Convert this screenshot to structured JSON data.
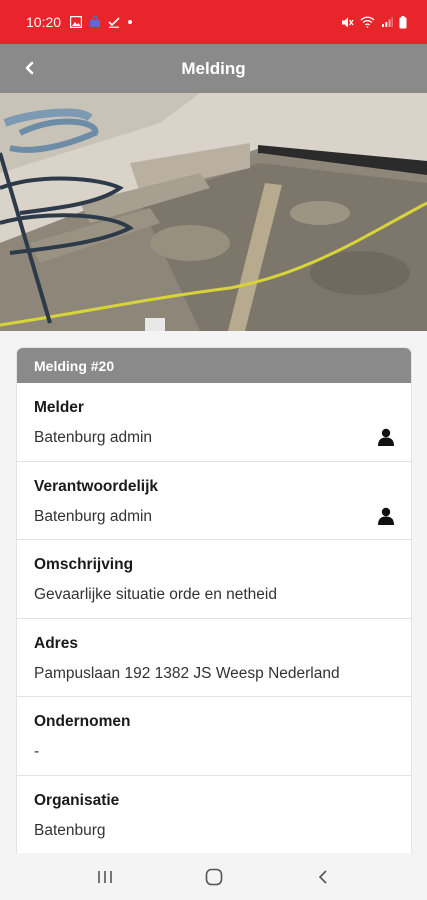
{
  "status_bar": {
    "time": "10:20",
    "left_icons": [
      "image-icon",
      "bag-icon",
      "checkmark-icon",
      "dot-icon"
    ],
    "right_icons": [
      "mute-icon",
      "wifi-icon",
      "signal-icon",
      "battery-icon"
    ],
    "color": "#e8252b"
  },
  "header": {
    "title": "Melding",
    "back_icon": "chevron-left-icon",
    "color": "#8a8a8a"
  },
  "photo": {
    "icon": "site-photo"
  },
  "card": {
    "title": "Melding #20",
    "fields": [
      {
        "label": "Melder",
        "value": "Batenburg admin",
        "icon": "person-icon"
      },
      {
        "label": "Verantwoordelijk",
        "value": "Batenburg admin",
        "icon": "person-icon"
      },
      {
        "label": "Omschrijving",
        "value": "Gevaarlijke situatie orde en netheid"
      },
      {
        "label": "Adres",
        "value": "Pampuslaan 192 1382 JS Weesp Nederland"
      },
      {
        "label": "Ondernomen",
        "value": "-"
      },
      {
        "label": "Organisatie",
        "value": "Batenburg"
      }
    ]
  },
  "nav_bar": {
    "buttons": [
      "recent-apps-icon",
      "home-icon",
      "back-icon"
    ]
  }
}
